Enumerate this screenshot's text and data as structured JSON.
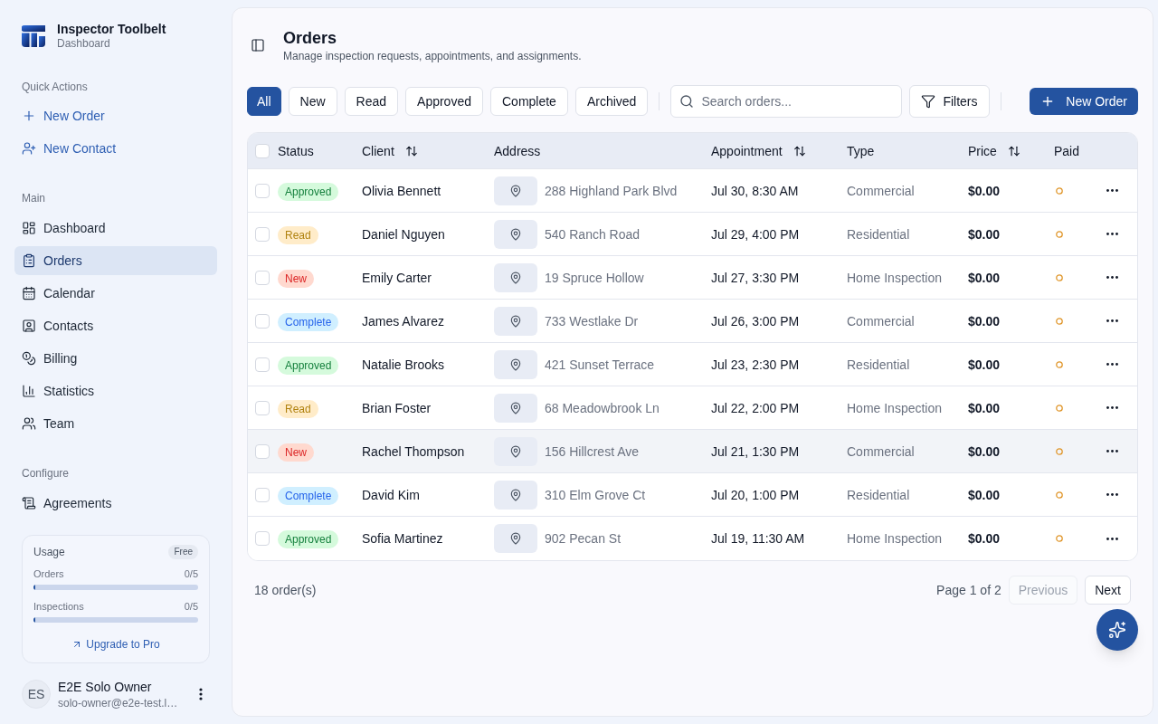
{
  "sidebar": {
    "brand": {
      "title": "Inspector Toolbelt",
      "subtitle": "Dashboard"
    },
    "quick_actions": {
      "heading": "Quick Actions",
      "items": [
        {
          "label": "New Order"
        },
        {
          "label": "New Contact"
        }
      ]
    },
    "nav_sections": [
      {
        "heading": "Main",
        "items": [
          {
            "label": "Dashboard",
            "selected": false
          },
          {
            "label": "Orders",
            "selected": true
          },
          {
            "label": "Calendar",
            "selected": false
          },
          {
            "label": "Contacts",
            "selected": false
          },
          {
            "label": "Billing",
            "selected": false
          },
          {
            "label": "Statistics",
            "selected": false
          },
          {
            "label": "Team",
            "selected": false
          }
        ]
      },
      {
        "heading": "Configure",
        "items": [
          {
            "label": "Agreements",
            "selected": false
          }
        ]
      }
    ],
    "usage": {
      "title": "Usage",
      "plan": "Free",
      "meters": [
        {
          "label": "Orders",
          "reading": "0/5",
          "level": 0
        },
        {
          "label": "Inspections",
          "reading": "0/5",
          "level": 0
        }
      ],
      "link": "Upgrade to Pro"
    },
    "user": {
      "initials": "ES",
      "name": "E2E Solo Owner",
      "email": "solo-owner@e2e-test.l…"
    }
  },
  "main": {
    "header": {
      "title": "Orders",
      "subtitle": "Manage inspection requests, appointments, and assignments."
    },
    "filters": [
      {
        "label": "All",
        "selected": true
      },
      {
        "label": "New",
        "selected": false
      },
      {
        "label": "Read",
        "selected": false
      },
      {
        "label": "Approved",
        "selected": false
      },
      {
        "label": "Complete",
        "selected": false
      },
      {
        "label": "Archived",
        "selected": false
      }
    ],
    "search": {
      "placeholder": "Search orders..."
    },
    "filters_button": "Filters",
    "new_order_button": "New Order",
    "table": {
      "select_all": {
        "checked": false
      },
      "columns": [
        {
          "label": "Status",
          "sortable": false
        },
        {
          "label": "Client",
          "sortable": true
        },
        {
          "label": "Address",
          "sortable": false
        },
        {
          "label": "Appointment",
          "sortable": true
        },
        {
          "label": "Type",
          "sortable": false
        },
        {
          "label": "Price",
          "sortable": true
        },
        {
          "label": "Paid",
          "sortable": false
        }
      ],
      "rows": [
        {
          "checked": false,
          "highlighted": false,
          "status": {
            "label": "Approved",
            "color": "#15803d"
          },
          "client": "Olivia Bennett",
          "address": "288 Highland Park Blvd",
          "appointment": "Jul 30, 8:30 AM",
          "type": "Commercial",
          "price": "$0.00",
          "paid": false
        },
        {
          "checked": false,
          "highlighted": false,
          "status": {
            "label": "Read",
            "color": "#b0820f"
          },
          "client": "Daniel Nguyen",
          "address": "540 Ranch Road",
          "appointment": "Jul 29, 4:00 PM",
          "type": "Residential",
          "price": "$0.00",
          "paid": false
        },
        {
          "checked": false,
          "highlighted": false,
          "status": {
            "label": "New",
            "color": "#dc2626"
          },
          "client": "Emily Carter",
          "address": "19 Spruce Hollow",
          "appointment": "Jul 27, 3:30 PM",
          "type": "Home Inspection",
          "price": "$0.00",
          "paid": false
        },
        {
          "checked": false,
          "highlighted": false,
          "status": {
            "label": "Complete",
            "color": "#2563eb"
          },
          "client": "James Alvarez",
          "address": "733 Westlake Dr",
          "appointment": "Jul 26, 3:00 PM",
          "type": "Commercial",
          "price": "$0.00",
          "paid": false
        },
        {
          "checked": false,
          "highlighted": false,
          "status": {
            "label": "Approved",
            "color": "#15803d"
          },
          "client": "Natalie Brooks",
          "address": "421 Sunset Terrace",
          "appointment": "Jul 23, 2:30 PM",
          "type": "Residential",
          "price": "$0.00",
          "paid": false
        },
        {
          "checked": false,
          "highlighted": false,
          "status": {
            "label": "Read",
            "color": "#b0820f"
          },
          "client": "Brian Foster",
          "address": "68 Meadowbrook Ln",
          "appointment": "Jul 22, 2:00 PM",
          "type": "Home Inspection",
          "price": "$0.00",
          "paid": false
        },
        {
          "checked": false,
          "highlighted": true,
          "status": {
            "label": "New",
            "color": "#dc2626"
          },
          "client": "Rachel Thompson",
          "address": "156 Hillcrest Ave",
          "appointment": "Jul 21, 1:30 PM",
          "type": "Commercial",
          "price": "$0.00",
          "paid": false
        },
        {
          "checked": false,
          "highlighted": false,
          "status": {
            "label": "Complete",
            "color": "#2563eb"
          },
          "client": "David Kim",
          "address": "310 Elm Grove Ct",
          "appointment": "Jul 20, 1:00 PM",
          "type": "Residential",
          "price": "$0.00",
          "paid": false
        },
        {
          "checked": false,
          "highlighted": false,
          "status": {
            "label": "Approved",
            "color": "#15803d"
          },
          "client": "Sofia Martinez",
          "address": "902 Pecan St",
          "appointment": "Jul 19, 11:30 AM",
          "type": "Home Inspection",
          "price": "$0.00",
          "paid": false
        }
      ]
    },
    "footer": {
      "count": "18 order(s)",
      "page": "Page 1 of 2",
      "previous": {
        "label": "Previous",
        "disabled": true
      },
      "next": {
        "label": "Next",
        "disabled": false
      }
    }
  }
}
